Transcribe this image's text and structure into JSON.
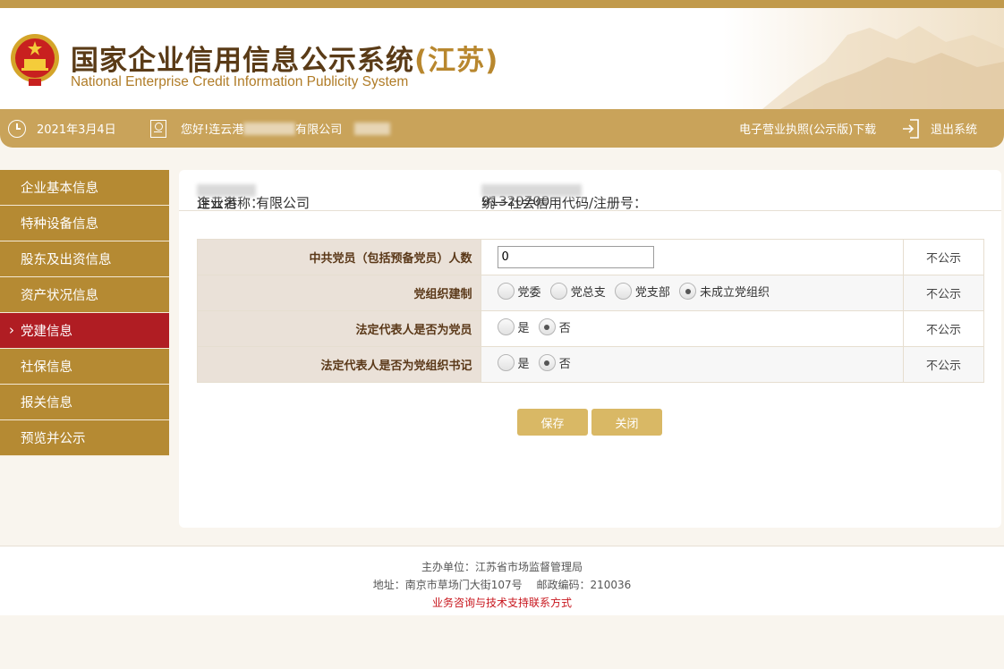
{
  "header": {
    "title_cn": "国家企业信用信息公示系统",
    "title_province": "(江苏)",
    "title_en": "National Enterprise Credit Information Publicity System"
  },
  "topbar": {
    "date": "2021年3月4日",
    "greeting_prefix": "您好!连云港",
    "greeting_suffix": "有限公司",
    "license_download": "电子营业执照(公示版)下载",
    "logout": "退出系统"
  },
  "sidebar": {
    "items": [
      {
        "label": "企业基本信息",
        "active": false
      },
      {
        "label": "特种设备信息",
        "active": false
      },
      {
        "label": "股东及出资信息",
        "active": false
      },
      {
        "label": "资产状况信息",
        "active": false
      },
      {
        "label": "党建信息",
        "active": true
      },
      {
        "label": "社保信息",
        "active": false
      },
      {
        "label": "报关信息",
        "active": false
      },
      {
        "label": "预览并公示",
        "active": false
      }
    ]
  },
  "company": {
    "name_label": "企业名称：",
    "name_prefix": "连云港",
    "name_suffix": "有限公司",
    "code_label": "统一社会信用代码/注册号：",
    "code_prefix": "91320700"
  },
  "form": {
    "rows": [
      {
        "label": "中共党员（包括预备党员）人数",
        "value": "0",
        "public": "不公示"
      },
      {
        "label": "党组织建制",
        "options": [
          "党委",
          "党总支",
          "党支部",
          "未成立党组织"
        ],
        "selected": "未成立党组织",
        "public": "不公示"
      },
      {
        "label": "法定代表人是否为党员",
        "options": [
          "是",
          "否"
        ],
        "selected": "否",
        "public": "不公示"
      },
      {
        "label": "法定代表人是否为党组织书记",
        "options": [
          "是",
          "否"
        ],
        "selected": "否",
        "public": "不公示"
      }
    ],
    "save_label": "保存",
    "close_label": "关闭"
  },
  "footer": {
    "sponsor": "主办单位：江苏省市场监督管理局",
    "address": "地址：南京市草场门大街107号　 邮政编码：210036",
    "support_link": "业务咨询与技术支持联系方式"
  },
  "colors": {
    "brand_gold": "#c9a35a",
    "sidebar_gold": "#b58a33",
    "active_red": "#b01d23",
    "button_gold": "#d9b865"
  }
}
